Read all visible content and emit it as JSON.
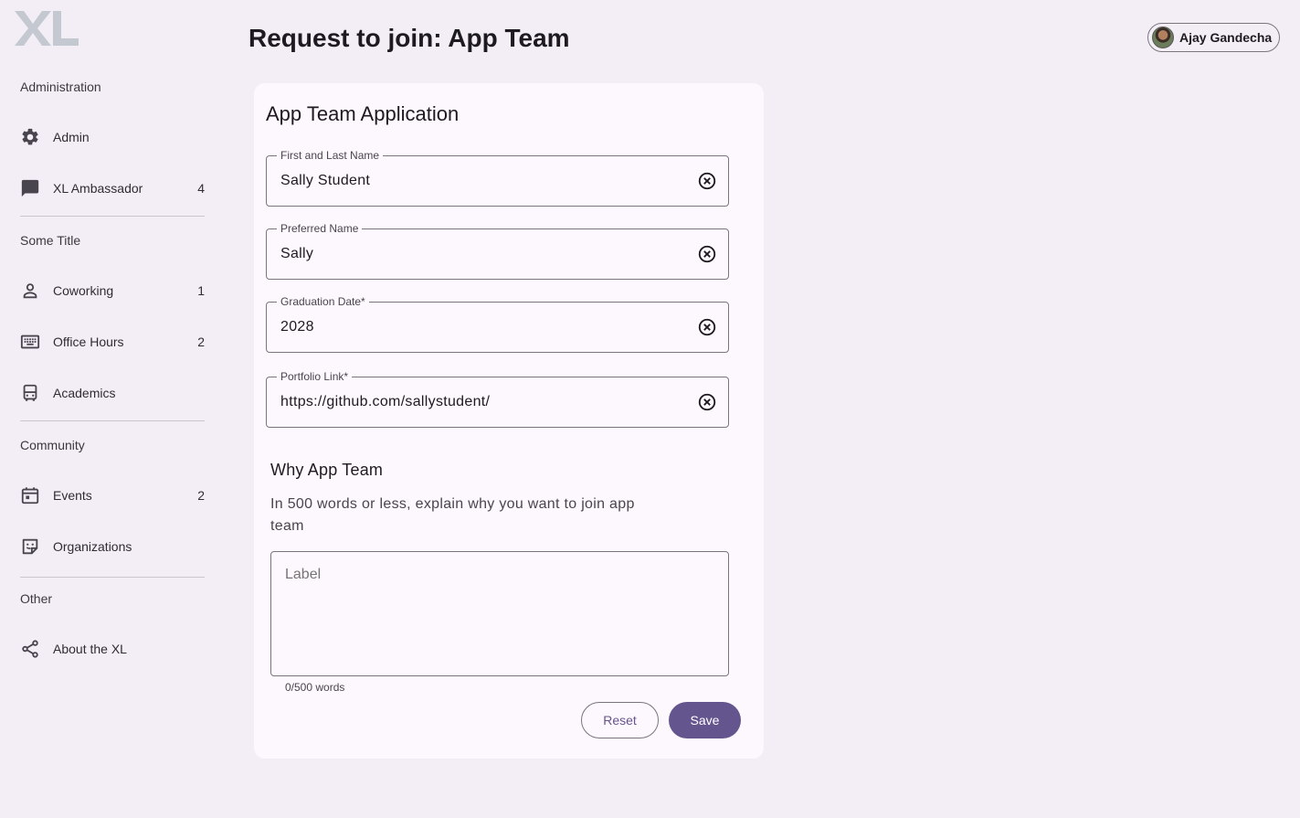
{
  "header": {
    "title": "Request to join: App Team",
    "user_name": "Ajay Gandecha"
  },
  "logo": {
    "text": "XL"
  },
  "sidebar": {
    "sections": [
      {
        "title": "Administration"
      },
      {
        "title": "Some Title"
      },
      {
        "title": "Community"
      },
      {
        "title": "Other"
      }
    ],
    "items": [
      {
        "label": "Admin",
        "icon": "gear-icon",
        "count": ""
      },
      {
        "label": "XL Ambassador",
        "icon": "chat-icon",
        "count": "4"
      },
      {
        "label": "Coworking",
        "icon": "person-icon",
        "count": "1"
      },
      {
        "label": "Office Hours",
        "icon": "keyboard-icon",
        "count": "2"
      },
      {
        "label": "Academics",
        "icon": "bus-icon",
        "count": ""
      },
      {
        "label": "Events",
        "icon": "calendar-icon",
        "count": "2"
      },
      {
        "label": "Organizations",
        "icon": "sticker-icon",
        "count": ""
      },
      {
        "label": "About the XL",
        "icon": "share-icon",
        "count": ""
      }
    ]
  },
  "form": {
    "title": "App Team Application",
    "fields": [
      {
        "label": "First and Last Name",
        "value": "Sally Student"
      },
      {
        "label": "Preferred Name",
        "value": "Sally"
      },
      {
        "label": "Graduation Date*",
        "value": "2028"
      },
      {
        "label": "Portfolio Link*",
        "value": "https://github.com/sallystudent/"
      }
    ],
    "why_title": "Why App Team",
    "why_description": "In 500 words or less, explain why you want to join app team",
    "textarea_placeholder": "Label",
    "counter": "0/500 words",
    "reset_label": "Reset",
    "save_label": "Save"
  },
  "colors": {
    "background": "#f3eef6",
    "card": "#fdf8fd",
    "primary": "#65558f",
    "outline": "#79747e"
  }
}
